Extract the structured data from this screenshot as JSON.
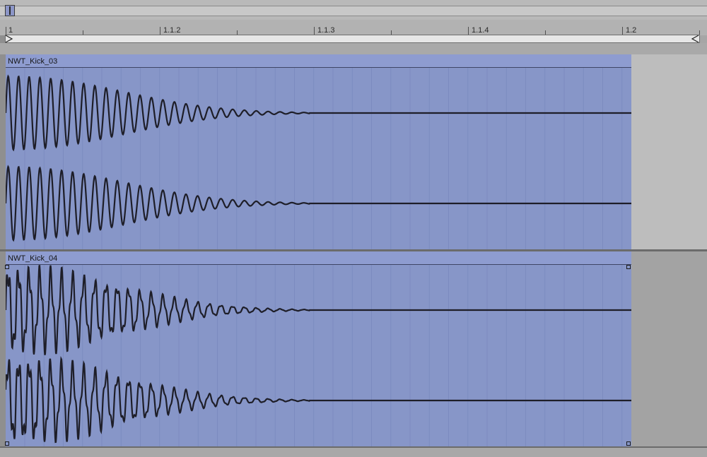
{
  "overview": {
    "handle_icon": "overview-handle"
  },
  "ruler": {
    "bar_labels": [
      "1",
      "1.1.2",
      "1.1.3",
      "1.1.4",
      "1.2"
    ]
  },
  "clips": [
    {
      "name": "NWT_Kick_03",
      "color": "#8796c8"
    },
    {
      "name": "NWT_Kick_04",
      "color": "#8796c8"
    }
  ],
  "colors": {
    "clip": "#8796c8",
    "waveform": "#1e1e28",
    "grid": "#7c8bbf",
    "empty_area": "#bdbdbd"
  }
}
